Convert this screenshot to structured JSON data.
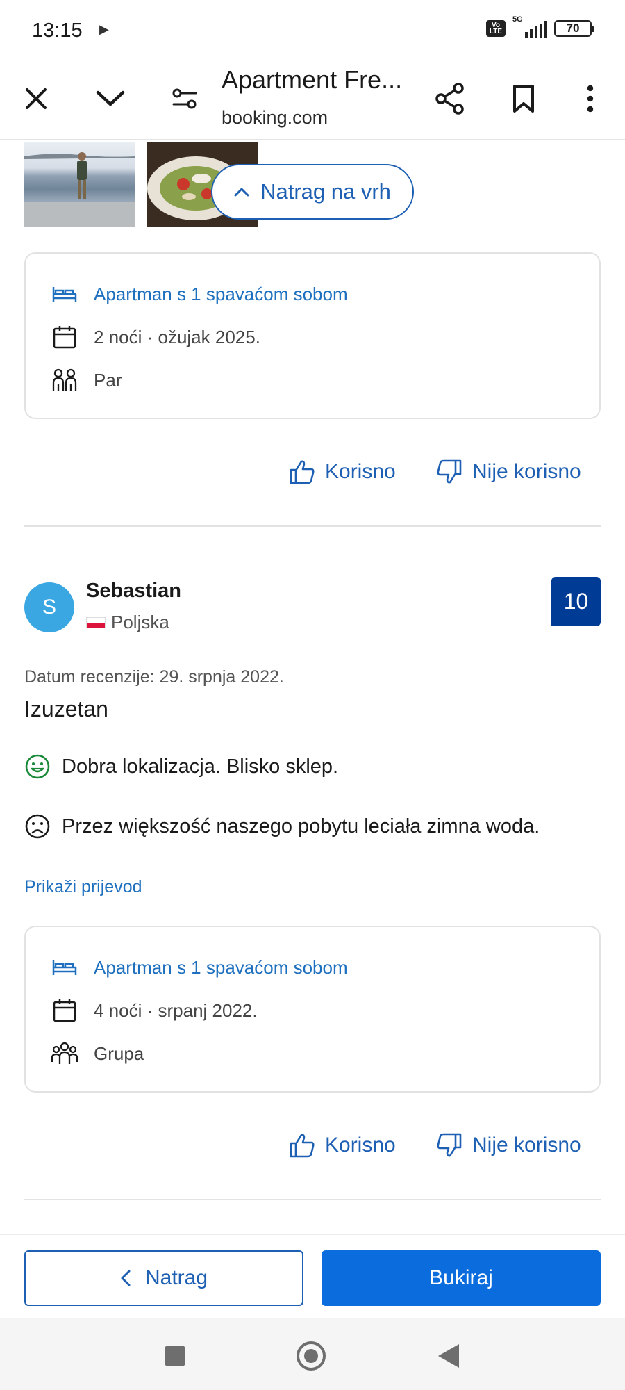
{
  "status_bar": {
    "time": "13:15",
    "network": "5G",
    "volte": "Vo LTE",
    "battery": "70"
  },
  "browser": {
    "title": "Apartment Fre...",
    "domain": "booking.com"
  },
  "floating": {
    "back_to_top": "Natrag na vrh"
  },
  "review_prev": {
    "room": "Apartman s 1 spavaćom sobom",
    "stay": "2 noći · ožujak 2025.",
    "traveler": "Par",
    "helpful": "Korisno",
    "not_helpful": "Nije korisno"
  },
  "review": {
    "avatar_letter": "S",
    "name": "Sebastian",
    "country": "Poljska",
    "score": "10",
    "date": "Datum recenzije: 29. srpnja 2022.",
    "title": "Izuzetan",
    "positive": "Dobra lokalizacja. Blisko sklep.",
    "negative": "Przez większość naszego pobytu leciała zimna woda.",
    "show_translation": "Prikaži prijevod",
    "room": "Apartman s 1 spavaćom sobom",
    "stay": "4 noći · srpanj 2022.",
    "traveler": "Grupa",
    "helpful": "Korisno",
    "not_helpful": "Nije korisno"
  },
  "actions": {
    "back": "Natrag",
    "book": "Bukiraj"
  },
  "colors": {
    "primary": "#1d5fb3",
    "book_button": "#0b6cde",
    "score_badge": "#003b95",
    "avatar": "#3aa7e2",
    "positive_icon": "#1a8a3a"
  }
}
